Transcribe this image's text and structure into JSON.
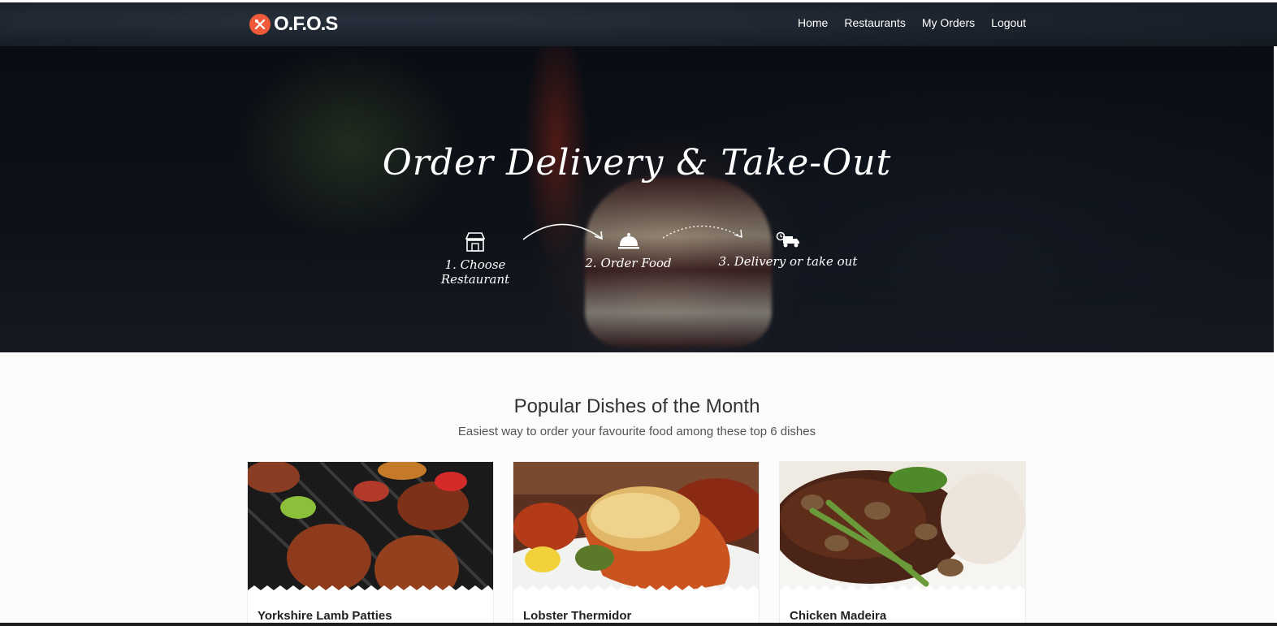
{
  "brand": {
    "name": "O.F.O.S",
    "logo_color": "#ef5a3a"
  },
  "nav": {
    "items": [
      {
        "label": "Home"
      },
      {
        "label": "Restaurants"
      },
      {
        "label": "My Orders"
      },
      {
        "label": "Logout"
      }
    ]
  },
  "hero": {
    "title": "Order Delivery & Take-Out",
    "steps": [
      {
        "label": "1. Choose Restaurant",
        "icon": "store-icon"
      },
      {
        "label": "2. Order Food",
        "icon": "cloche-icon"
      },
      {
        "label": "3. Delivery or take out",
        "icon": "delivery-truck-icon"
      }
    ]
  },
  "popular": {
    "title": "Popular Dishes of the Month",
    "subtitle": "Easiest way to order your favourite food among these top 6 dishes",
    "dishes": [
      {
        "name": "Yorkshire Lamb Patties"
      },
      {
        "name": "Lobster Thermidor"
      },
      {
        "name": "Chicken Madeira"
      }
    ]
  }
}
